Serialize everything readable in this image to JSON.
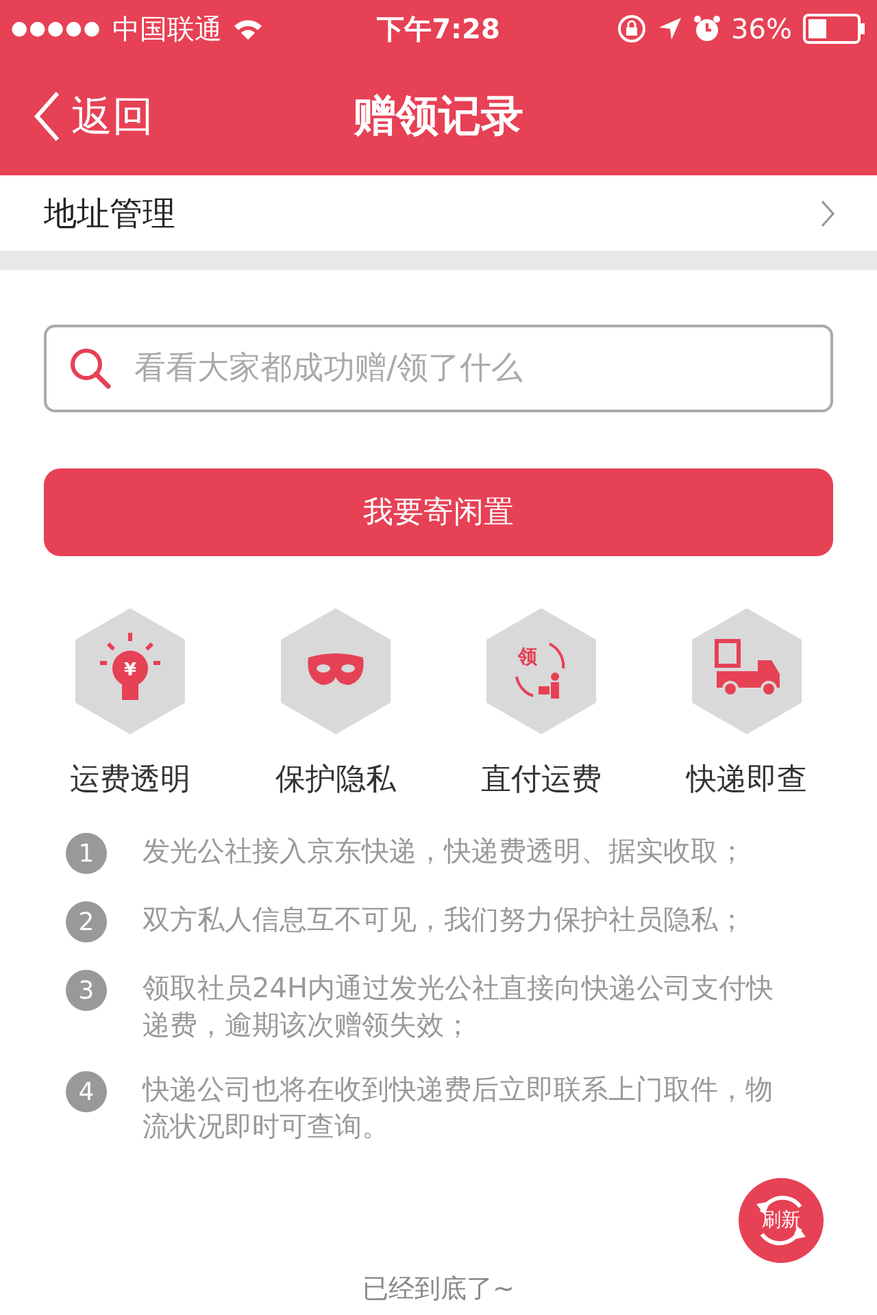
{
  "status_bar": {
    "signal_dots": "●●●●●",
    "carrier": "中国联通",
    "time": "下午7:28",
    "battery": "36%"
  },
  "nav": {
    "back": "返回",
    "title": "赠领记录"
  },
  "address_row": {
    "label": "地址管理"
  },
  "search": {
    "placeholder": "看看大家都成功赠/领了什么"
  },
  "primary_button": "我要寄闲置",
  "features": [
    {
      "kind": "bulb",
      "glyph": "¥",
      "label": "运费透明"
    },
    {
      "kind": "mask",
      "label": "保护隐私"
    },
    {
      "kind": "receive",
      "glyph": "领",
      "label": "直付运费"
    },
    {
      "kind": "truck",
      "label": "快递即查"
    }
  ],
  "notes": [
    {
      "number": "1",
      "text": "发光公社接入京东快递，快递费透明、据实收取；"
    },
    {
      "number": "2",
      "text": "双方私人信息互不可见，我们努力保护社员隐私；"
    },
    {
      "number": "3",
      "text": "领取社员24H内通过发光公社直接向快递公司支付快递费，逾期该次赠领失效；"
    },
    {
      "number": "4",
      "text": "快递公司也将在收到快递费后立即联系上门取件，物流状况即时可查询。"
    }
  ],
  "refresh_button": "刷新",
  "footer": "已经到底了~"
}
